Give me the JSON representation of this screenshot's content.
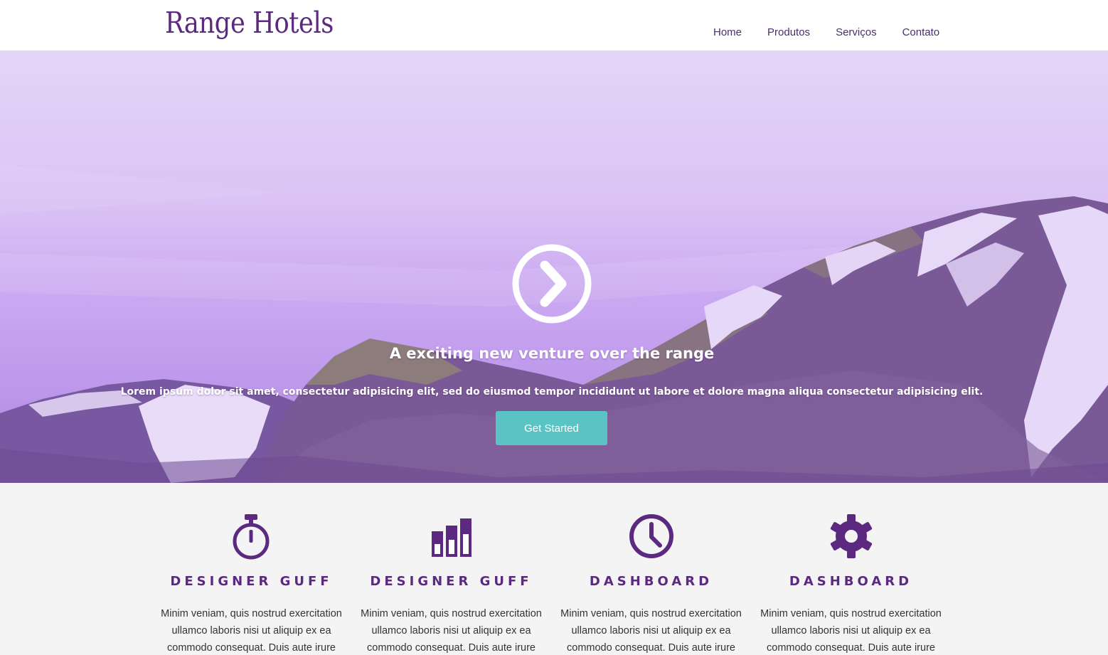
{
  "header": {
    "logo": "Range Hotels",
    "nav": [
      "Home",
      "Produtos",
      "Serviços",
      "Contato"
    ]
  },
  "hero": {
    "icon": "chevron-right-circle-icon",
    "title": "A exciting new venture over the range",
    "text": "Lorem ipsum dolor sit amet, consectetur adipisicing elit, sed do eiusmod tempor incididunt ut labore et dolore magna aliqua consectetur adipisicing elit.",
    "cta_label": "Get Started"
  },
  "features": [
    {
      "icon": "stopwatch-icon",
      "title": "DESIGNER GUFF",
      "text": "Minim veniam, quis nostrud exercitation ullamco laboris nisi ut aliquip ex ea commodo consequat. Duis aute irure"
    },
    {
      "icon": "bar-chart-icon",
      "title": "DESIGNER GUFF",
      "text": "Minim veniam, quis nostrud exercitation ullamco laboris nisi ut aliquip ex ea commodo consequat. Duis aute irure"
    },
    {
      "icon": "clock-icon",
      "title": "DASHBOARD",
      "text": "Minim veniam, quis nostrud exercitation ullamco laboris nisi ut aliquip ex ea commodo consequat. Duis aute irure"
    },
    {
      "icon": "gear-icon",
      "title": "DASHBOARD",
      "text": "Minim veniam, quis nostrud exercitation ullamco laboris nisi ut aliquip ex ea commodo consequat. Duis aute irure"
    }
  ],
  "colors": {
    "brand": "#5b2a80",
    "accent": "#5ac3c3",
    "hero_tint": "#c6a2ef"
  }
}
